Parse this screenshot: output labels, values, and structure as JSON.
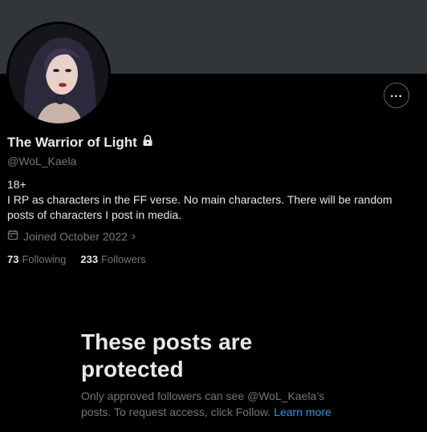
{
  "profile": {
    "display_name": "The Warrior of Light",
    "handle": "@WoL_Kaela",
    "bio_line1": "18+",
    "bio_line2": "I RP as characters in the FF verse. No main characters. There will be random posts of characters I post in media.",
    "joined": "Joined October 2022",
    "following_count": "73",
    "following_label": "Following",
    "followers_count": "233",
    "followers_label": "Followers",
    "icons": {
      "lock": "lock-icon",
      "calendar": "calendar-icon",
      "more": "more-options-icon",
      "chevron": "chevron-right-icon"
    }
  },
  "protected_notice": {
    "title": "These posts are protected",
    "description": "Only approved followers can see @WoL_Kaela’s posts. To request access, click Follow.",
    "link": "Learn more"
  },
  "colors": {
    "background": "#000000",
    "banner": "#333639",
    "text": "#e7e9ea",
    "muted": "#71767b",
    "link": "#1d9bf0"
  }
}
